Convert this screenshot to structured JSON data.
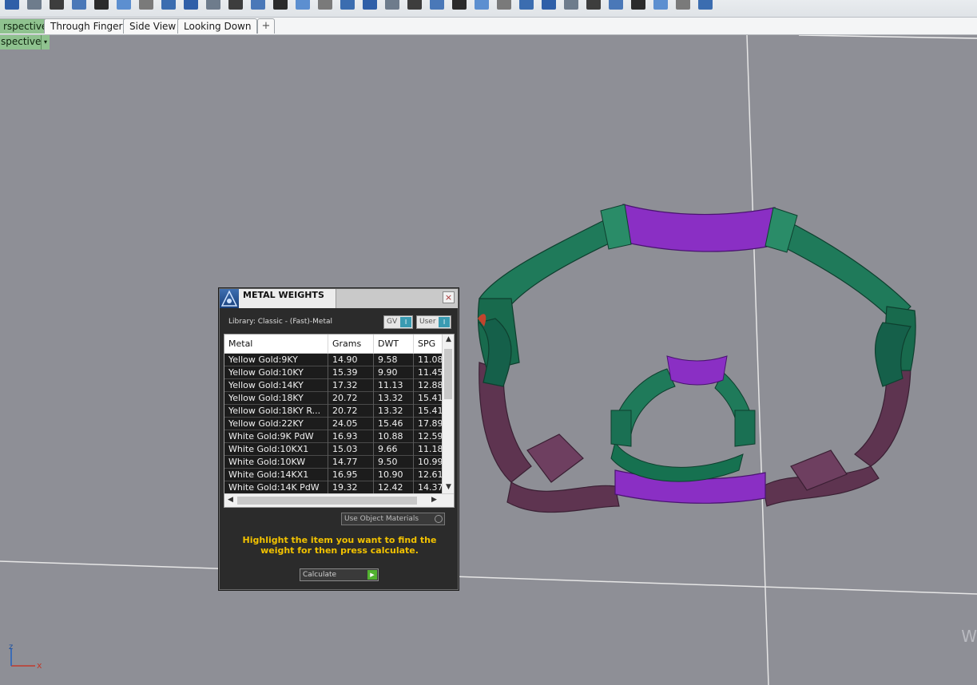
{
  "toolbar": {
    "icons": [
      "tool-icon",
      "gallery-icon",
      "curve-icon",
      "grid-icon",
      "figure-icon",
      "figure-icon",
      "figure-icon",
      "cylinder-icon",
      "plane-icon",
      "box-icon",
      "move-icon",
      "cut-icon",
      "pen-icon",
      "sweep-icon",
      "grid-icon",
      "surface-icon",
      "surface-icon",
      "globe-icon",
      "globe-icon",
      "sculpt-icon",
      "brush-icon",
      "move-icon",
      "square-icon",
      "frame-icon",
      "cube-icon",
      "cube-icon",
      "hatch-icon",
      "hatch-icon",
      "wall-icon",
      "hatch-icon",
      "stack-icon",
      "settings-icon"
    ]
  },
  "tabs": {
    "items": [
      {
        "label": "rspective",
        "active": true
      },
      {
        "label": "Through Finger",
        "active": false
      },
      {
        "label": "Side View",
        "active": false
      },
      {
        "label": "Looking Down",
        "active": false
      }
    ],
    "add_label": "+"
  },
  "viewport": {
    "label": "spective",
    "dropdown": "▾"
  },
  "dialog": {
    "title": "METAL WEIGHTS",
    "close": "×",
    "library_label": "Library: Classic - (Fast)-Metal",
    "gv_label": "GV",
    "user_label": "User",
    "toggle_glyph": "I",
    "columns": [
      "Metal",
      "Grams",
      "DWT",
      "SPG"
    ],
    "rows": [
      {
        "metal": "Yellow Gold:9KY",
        "grams": "14.90",
        "dwt": "9.58",
        "spg": "11.08"
      },
      {
        "metal": "Yellow Gold:10KY",
        "grams": "15.39",
        "dwt": "9.90",
        "spg": "11.45"
      },
      {
        "metal": "Yellow Gold:14KY",
        "grams": "17.32",
        "dwt": "11.13",
        "spg": "12.88"
      },
      {
        "metal": "Yellow Gold:18KY",
        "grams": "20.72",
        "dwt": "13.32",
        "spg": "15.41"
      },
      {
        "metal": "Yellow Gold:18KY R...",
        "grams": "20.72",
        "dwt": "13.32",
        "spg": "15.41"
      },
      {
        "metal": "Yellow Gold:22KY",
        "grams": "24.05",
        "dwt": "15.46",
        "spg": "17.89"
      },
      {
        "metal": "White Gold:9K PdW",
        "grams": "16.93",
        "dwt": "10.88",
        "spg": "12.59"
      },
      {
        "metal": "White Gold:10KX1",
        "grams": "15.03",
        "dwt": "9.66",
        "spg": "11.18"
      },
      {
        "metal": "White Gold:10KW",
        "grams": "14.77",
        "dwt": "9.50",
        "spg": "10.99"
      },
      {
        "metal": "White Gold:14KX1",
        "grams": "16.95",
        "dwt": "10.90",
        "spg": "12.61"
      },
      {
        "metal": "White Gold:14K PdW",
        "grams": "19.32",
        "dwt": "12.42",
        "spg": "14.37"
      }
    ],
    "use_object_materials": "Use Object Materials",
    "hint": "Highlight the item you want to find the weight for then press calculate.",
    "calculate_label": "Calculate"
  },
  "scene": {
    "axis_labels": {
      "x": "x",
      "z": "z"
    },
    "watermark": "W"
  },
  "colors": {
    "viewport_bg": "#8e8f96",
    "ring_green": "#1f7a5a",
    "ring_purple": "#8a2fc4",
    "ring_mauve": "#5e3450",
    "hint_yellow": "#f2c200",
    "active_tab": "#8fc28f"
  }
}
